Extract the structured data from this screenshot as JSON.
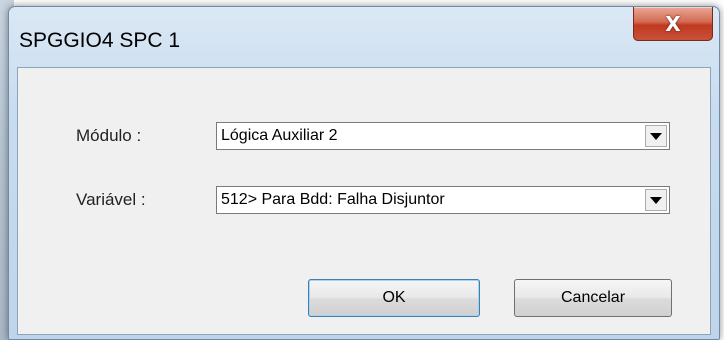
{
  "window": {
    "title": "SPGGIO4 SPC 1",
    "close_glyph": "X"
  },
  "form": {
    "modulo_label": "Módulo :",
    "modulo_value": "Lógica Auxiliar 2",
    "variavel_label": "Variável :",
    "variavel_value": "512> Para Bdd: Falha Disjuntor"
  },
  "buttons": {
    "ok_label": "OK",
    "cancel_label": "Cancelar"
  },
  "icons": {
    "close": "close-icon",
    "dropdown": "chevron-down-icon"
  },
  "colors": {
    "close_button": "#c8513a",
    "title_bar": "#c9dcef",
    "client_bg": "#f0f0f0"
  }
}
